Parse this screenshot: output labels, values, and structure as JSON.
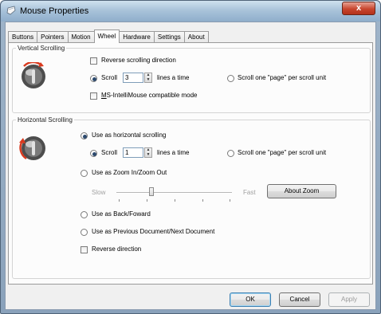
{
  "window": {
    "title": "Mouse Properties",
    "close_glyph": "x"
  },
  "tabs": [
    {
      "label": "Buttons",
      "active": false
    },
    {
      "label": "Pointers",
      "active": false
    },
    {
      "label": "Motion",
      "active": false
    },
    {
      "label": "Wheel",
      "active": true
    },
    {
      "label": "Hardware",
      "active": false
    },
    {
      "label": "Settings",
      "active": false
    },
    {
      "label": "About",
      "active": false
    }
  ],
  "vertical": {
    "legend": "Vertical Scrolling",
    "reverse_label": "Reverse scrolling direction",
    "reverse_checked": false,
    "scroll_label": "Scroll",
    "scroll_value": "3",
    "lines_label": "lines a time",
    "page_label": "Scroll one \"page\" per scroll unit",
    "scroll_selected": true,
    "compat_label": "MS-IntelliMouse compatible mode",
    "compat_checked": false
  },
  "horizontal": {
    "legend": "Horizontal Scrolling",
    "use_scroll_label": "Use as horizontal scrolling",
    "scroll_label": "Scroll",
    "scroll_value": "1",
    "lines_label": "lines a time",
    "page_label": "Scroll one \"page\" per scroll unit",
    "zoom_label": "Use as Zoom In/Zoom Out",
    "slow_label": "Slow",
    "fast_label": "Fast",
    "about_zoom_label": "About Zoom",
    "zoom_speed": 0.3,
    "back_forward_label": "Use as Back/Foward",
    "prev_next_label": "Use as Previous Document/Next Document",
    "reverse_label": "Reverse direction",
    "reverse_checked": false
  },
  "footer": {
    "ok_label": "OK",
    "cancel_label": "Cancel",
    "apply_label": "Apply"
  },
  "icons": {
    "title": "mouse-icon",
    "vertical": "vertical-wheel-icon",
    "horizontal": "horizontal-wheel-icon",
    "accent": "#d93a1f"
  }
}
